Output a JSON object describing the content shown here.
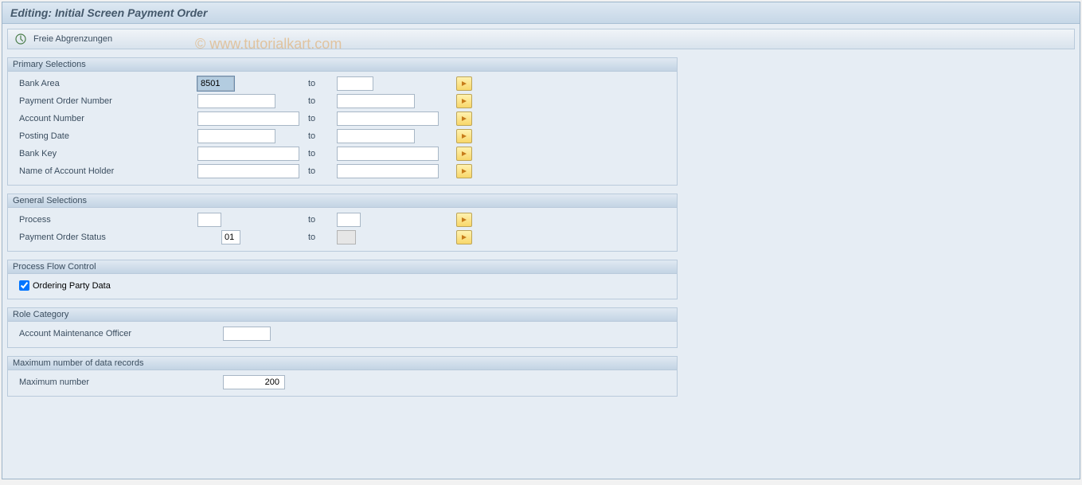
{
  "title": "Editing: Initial Screen Payment Order",
  "toolbar": {
    "freie": "Freie Abgrenzungen"
  },
  "watermark": "© www.tutorialkart.com",
  "labels": {
    "to": "to"
  },
  "groups": {
    "primary": {
      "title": "Primary Selections",
      "rows": {
        "bank_area": {
          "label": "Bank Area",
          "from": "8501",
          "to": ""
        },
        "po_number": {
          "label": "Payment Order Number",
          "from": "",
          "to": ""
        },
        "account": {
          "label": "Account Number",
          "from": "",
          "to": ""
        },
        "posting_date": {
          "label": "Posting Date",
          "from": "",
          "to": ""
        },
        "bank_key": {
          "label": "Bank Key",
          "from": "",
          "to": ""
        },
        "holder": {
          "label": "Name of Account Holder",
          "from": "",
          "to": ""
        }
      }
    },
    "general": {
      "title": "General Selections",
      "rows": {
        "process": {
          "label": "Process",
          "from": "",
          "to": ""
        },
        "po_status": {
          "label": "Payment Order Status",
          "from": "01",
          "to": ""
        }
      }
    },
    "flow": {
      "title": "Process Flow Control",
      "ordering_party_label": "Ordering Party Data",
      "ordering_party_checked": true
    },
    "role": {
      "title": "Role Category",
      "officer_label": "Account Maintenance Officer",
      "officer_value": ""
    },
    "max": {
      "title": "Maximum number of data records",
      "max_label": "Maximum number",
      "max_value": "200"
    }
  }
}
